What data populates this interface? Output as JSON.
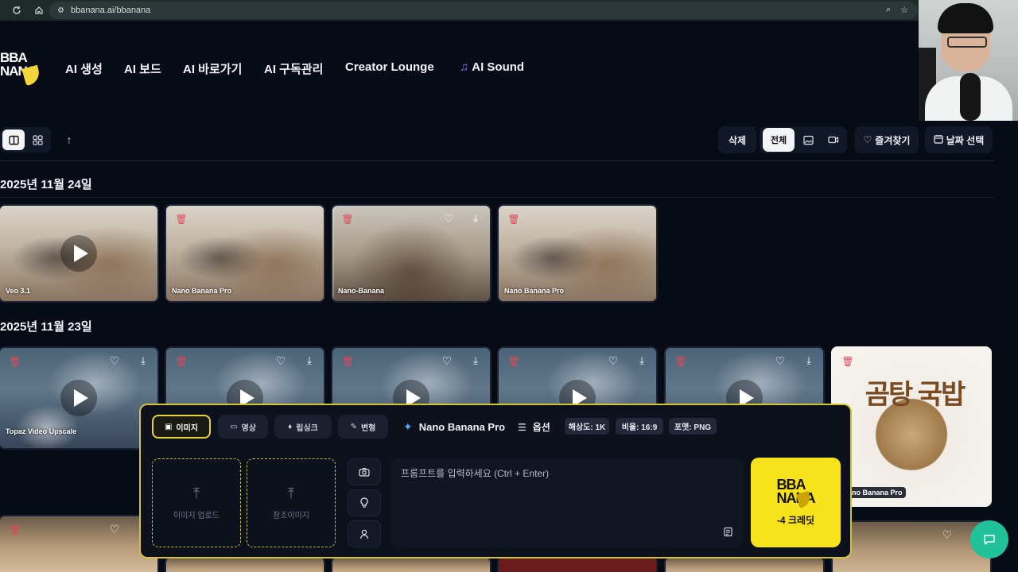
{
  "browser": {
    "url": "bbanana.ai/bbanana"
  },
  "logo": {
    "line1": "BBA",
    "line2": "NANA"
  },
  "nav": {
    "items": [
      {
        "label": "AI 생성"
      },
      {
        "label": "AI 보드"
      },
      {
        "label": "AI 바로가기"
      },
      {
        "label": "AI 구독관리"
      },
      {
        "label": "Creator Lounge"
      },
      {
        "label": "AI Sound"
      }
    ]
  },
  "toolbar": {
    "delete_label": "삭제",
    "filter_all_label": "전체",
    "favorites_label": "즐겨찾기",
    "date_select_label": "날짜 선택"
  },
  "gallery": {
    "groups": [
      {
        "date": "2025년 11월 24일",
        "items": [
          {
            "model": "Veo 3.1",
            "type": "video"
          },
          {
            "model": "Nano Banana Pro",
            "type": "image"
          },
          {
            "model": "Nano-Banana",
            "type": "image"
          },
          {
            "model": "Nano Banana Pro",
            "type": "image"
          }
        ]
      },
      {
        "date": "2025년 11월 23일",
        "items": [
          {
            "model": "Topaz Video Upscale",
            "type": "video"
          },
          {
            "model": "",
            "type": "video"
          },
          {
            "model": "",
            "type": "video"
          },
          {
            "model": "",
            "type": "video"
          },
          {
            "model": "",
            "type": "video"
          },
          {
            "model": "no Banana Pro",
            "type": "image",
            "image_text": "곰탕 국밥"
          }
        ]
      }
    ]
  },
  "prompt_panel": {
    "tabs": [
      {
        "label": "이미지",
        "icon": "image-icon",
        "active": true
      },
      {
        "label": "영상",
        "icon": "video-icon",
        "active": false
      },
      {
        "label": "립싱크",
        "icon": "mic-icon",
        "active": false
      },
      {
        "label": "변형",
        "icon": "wand-icon",
        "active": false
      }
    ],
    "model": "Nano Banana Pro",
    "options_label": "옵션",
    "chips": [
      "해상도: 1K",
      "비율: 16:9",
      "포맷: PNG"
    ],
    "upload_label": "이미지 업로드",
    "reference_label": "참조이미지",
    "prompt_placeholder": "프롬프트를 입력하세요 (Ctrl + Enter)",
    "generate": {
      "logo_line1": "BBA",
      "logo_line2": "NANA",
      "credit_label": "-4 크레딧"
    }
  },
  "colors": {
    "accent_yellow": "#f7e21c",
    "panel_border": "#d4c33a",
    "delete_red": "#e0485a",
    "chat_green": "#21c29a",
    "background": "#070b16"
  }
}
